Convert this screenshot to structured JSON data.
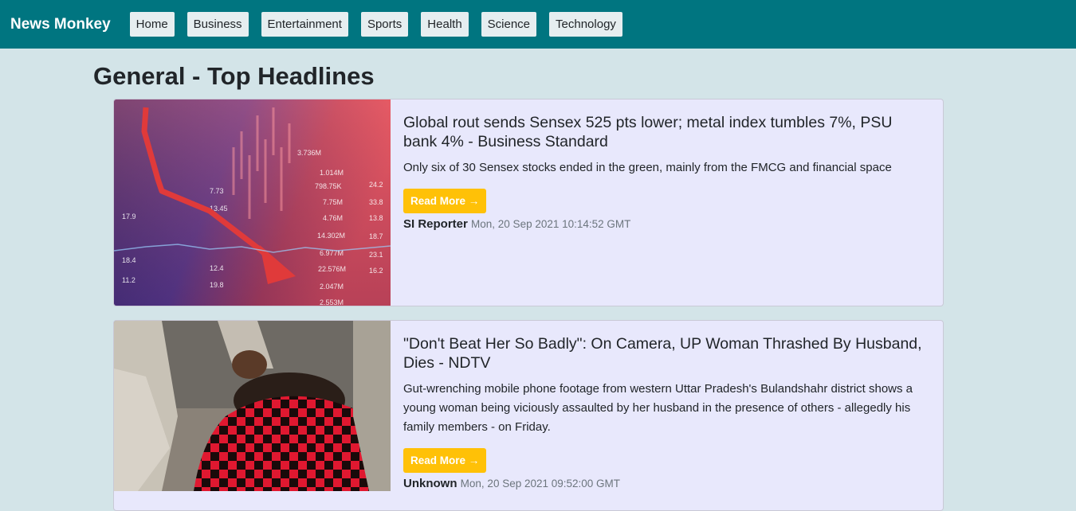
{
  "navbar": {
    "brand": "News Monkey",
    "links": [
      "Home",
      "Business",
      "Entertainment",
      "Sports",
      "Health",
      "Science",
      "Technology"
    ]
  },
  "page_title": "General - Top Headlines",
  "articles": [
    {
      "title": "Global rout sends Sensex 525 pts lower; metal index tumbles 7%, PSU bank 4% - Business Standard",
      "description": "Only six of 30 Sensex stocks ended in the green, mainly from the FMCG and financial space",
      "button": "Read More →",
      "author": "SI Reporter",
      "date": "Mon, 20 Sep 2021 10:14:52 GMT",
      "image": "stock-market-chart-image"
    },
    {
      "title": "\"Don't Beat Her So Badly\": On Camera, UP Woman Thrashed By Husband, Dies - NDTV",
      "description": "Gut-wrenching mobile phone footage from western Uttar Pradesh's Bulandshahr district shows a young woman being viciously assaulted by her husband in the presence of others - allegedly his family members - on Friday.",
      "button": "Read More →",
      "author": "Unknown",
      "date": "Mon, 20 Sep 2021 09:52:00 GMT",
      "image": "news-photo-image"
    }
  ],
  "colors": {
    "navbar": "#007580",
    "background": "#d3e4e8",
    "card": "#e8e8fc",
    "button": "#ffc107"
  }
}
